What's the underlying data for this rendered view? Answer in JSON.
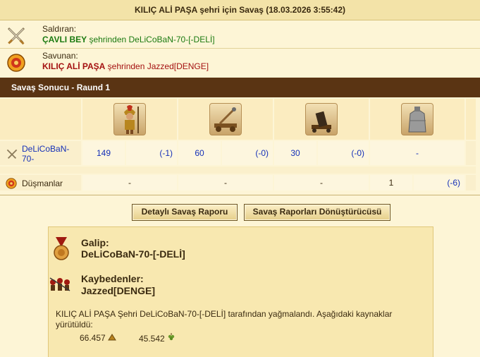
{
  "title": "KILIÇ ALİ PAŞA şehri için Savaş (18.03.2026 3:55:42)",
  "attacker": {
    "role": "Saldıran:",
    "name": "ÇAVLI BEY",
    "from_text": " şehrinden DeLiCoBaN-70-[-DELİ]"
  },
  "defender": {
    "role": "Savunan:",
    "name": "KILIÇ ALİ PAŞA",
    "from_text": " şehrinden Jazzed[DENGE]"
  },
  "section_title": "Savaş Sonucu - Raund 1",
  "units": [
    {
      "icon": "spartan-hoplite-icon"
    },
    {
      "icon": "catapult-icon"
    },
    {
      "icon": "mortar-icon"
    },
    {
      "icon": "wall-icon"
    }
  ],
  "rows": [
    {
      "label": "DeLiCoBaN-70-",
      "icon": "crossed-swords-icon",
      "cells": [
        [
          "149",
          "(-1)"
        ],
        [
          "60",
          "(-0)"
        ],
        [
          "30",
          "(-0)"
        ],
        [
          "-",
          ""
        ]
      ]
    },
    {
      "label": "Düşmanlar",
      "icon": "shield-icon",
      "cells": [
        [
          "-",
          ""
        ],
        [
          "-",
          ""
        ],
        [
          "-",
          ""
        ],
        [
          "1",
          "(-6)"
        ]
      ]
    }
  ],
  "buttons": {
    "detailed": "Detaylı Savaş Raporu",
    "converter": "Savaş Raporları Dönüştürücüsü"
  },
  "result": {
    "winner_label": "Galip:",
    "winner": "DeLiCoBaN-70-[-DELİ]",
    "loser_label": "Kaybedenler:",
    "loser": "Jazzed[DENGE]",
    "summary": "KILIÇ ALİ PAŞA Şehri DeLiCoBaN-70-[-DELİ] tarafından yağmalandı. Aşağıdaki kaynaklar yürütüldü:",
    "resources": [
      {
        "amount": "66.457",
        "icon": "wood-icon"
      },
      {
        "amount": "45.542",
        "icon": "wine-icon"
      }
    ]
  },
  "colors": {
    "header_bar": "#5a3413",
    "link_blue": "#1530b8",
    "green": "#1a7a10",
    "red": "#a41010"
  }
}
